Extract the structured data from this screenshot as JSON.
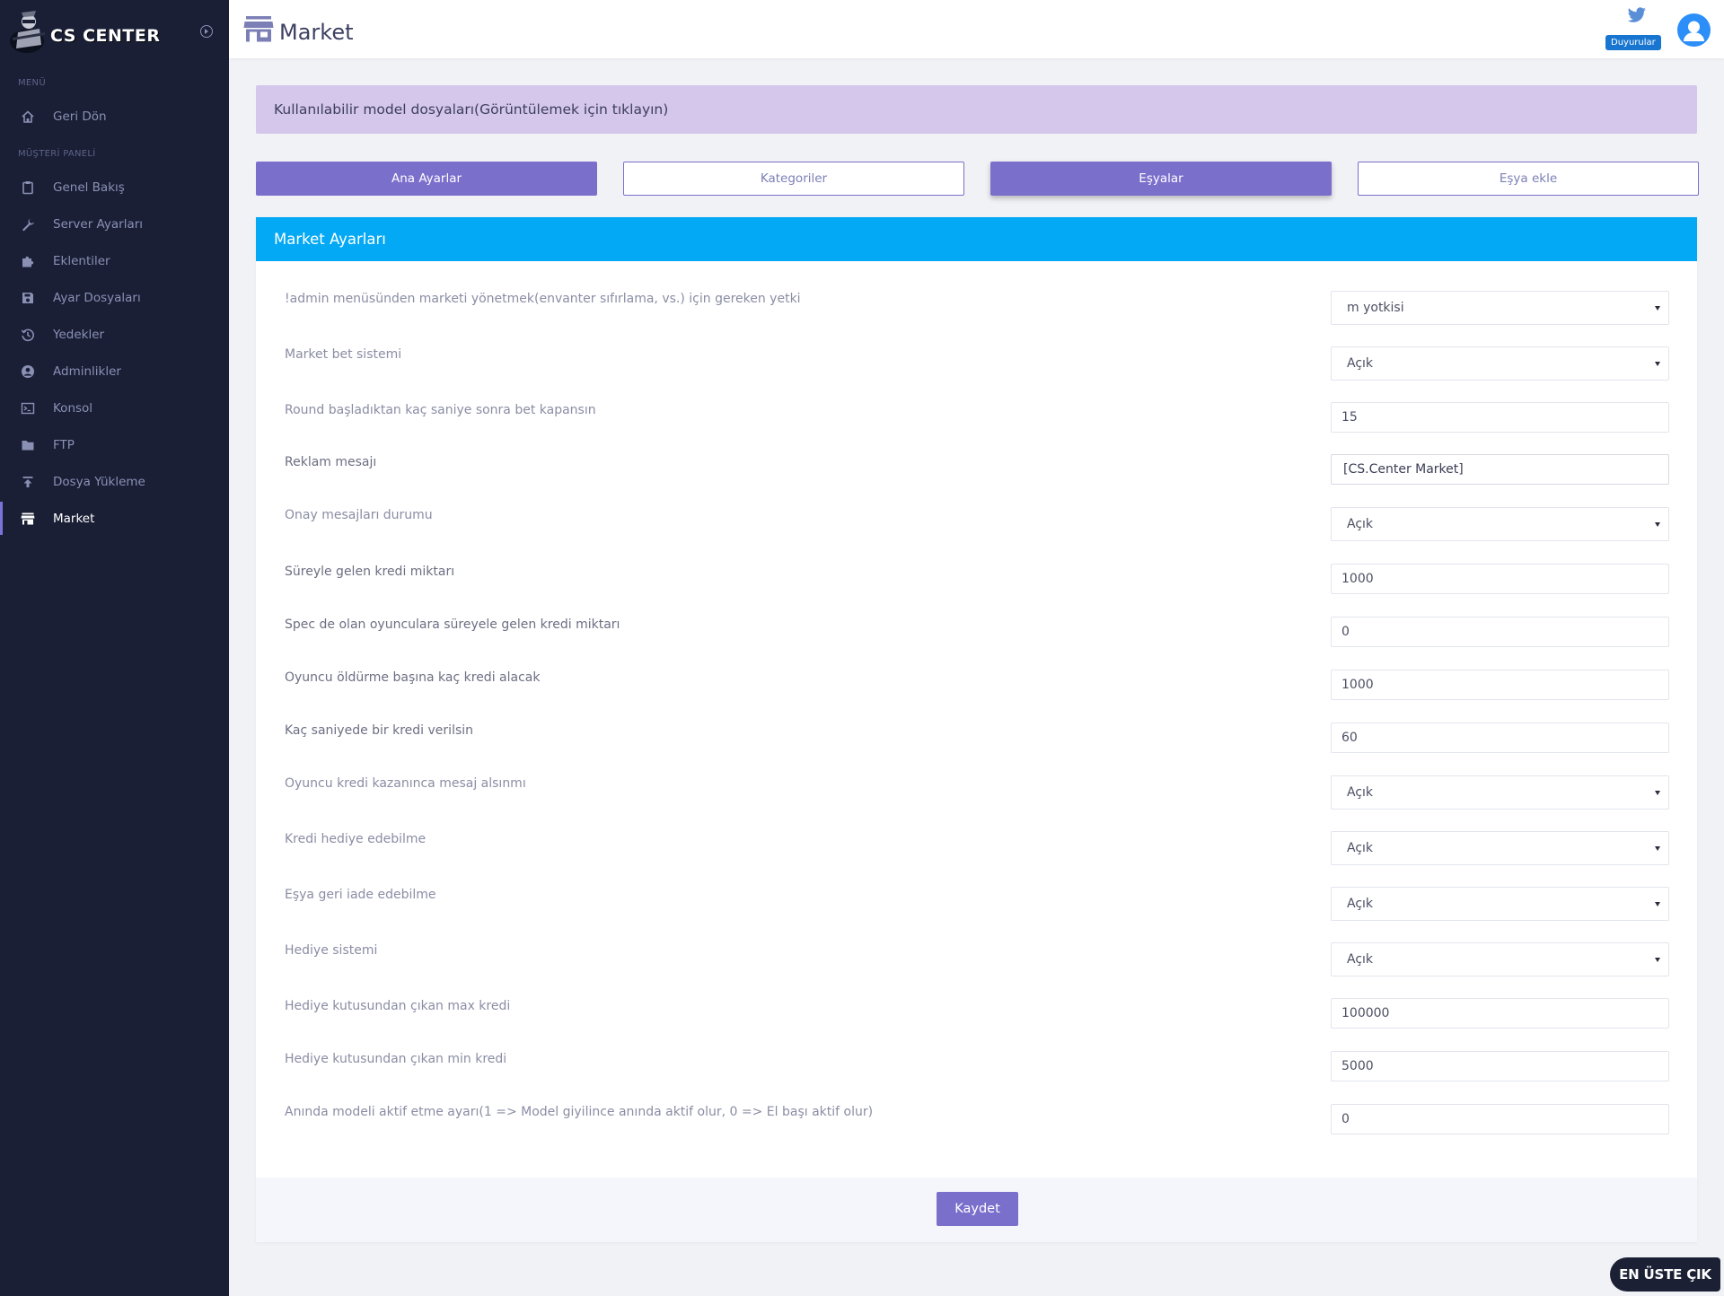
{
  "brand": {
    "name": "CS CENTER"
  },
  "sidebar": {
    "sections": {
      "menu": "MENÜ",
      "customer": "MÜŞTERİ PANELİ"
    },
    "items": [
      {
        "label": "Geri Dön",
        "icon": "home-icon"
      },
      {
        "label": "Genel Bakış",
        "icon": "clipboard-icon"
      },
      {
        "label": "Server Ayarları",
        "icon": "wrench-icon"
      },
      {
        "label": "Eklentiler",
        "icon": "puzzle-icon"
      },
      {
        "label": "Ayar Dosyaları",
        "icon": "save-icon"
      },
      {
        "label": "Yedekler",
        "icon": "history-icon"
      },
      {
        "label": "Adminlikler",
        "icon": "user-circle-icon"
      },
      {
        "label": "Konsol",
        "icon": "terminal-icon"
      },
      {
        "label": "FTP",
        "icon": "folder-icon"
      },
      {
        "label": "Dosya Yükleme",
        "icon": "upload-icon"
      },
      {
        "label": "Market",
        "icon": "store-icon",
        "active": true
      }
    ]
  },
  "header": {
    "title": "Market",
    "announcements_label": "Duyurular"
  },
  "alert": {
    "text": "Kullanılabilir model dosyaları(Görüntülemek için tıklayın)"
  },
  "tabs": [
    {
      "label": "Ana Ayarlar",
      "style": "filled"
    },
    {
      "label": "Kategoriler",
      "style": "outline"
    },
    {
      "label": "Eşyalar",
      "style": "filled"
    },
    {
      "label": "Eşya ekle",
      "style": "outline"
    }
  ],
  "card": {
    "title": "Market Ayarları",
    "rows": [
      {
        "label": "!admin menüsünden marketi yönetmek(envanter sıfırlama, vs.) için gereken yetki",
        "value": "m yotkisi",
        "type": "select"
      },
      {
        "label": "Market bet sistemi",
        "value": "Açık",
        "type": "select"
      },
      {
        "label": "Round başladıktan kaç saniye sonra bet kapansın",
        "value": "15",
        "type": "input"
      },
      {
        "label": "Reklam mesajı",
        "value": "[CS.Center Market]",
        "type": "input"
      },
      {
        "label": "Onay mesajları durumu",
        "value": "Açık",
        "type": "select"
      },
      {
        "label": "Süreyle gelen kredi miktarı",
        "value": "1000",
        "type": "input"
      },
      {
        "label": "Spec de olan oyunculara süreyele gelen kredi miktarı",
        "value": "0",
        "type": "input"
      },
      {
        "label": "Oyuncu öldürme başına kaç kredi alacak",
        "value": "1000",
        "type": "input"
      },
      {
        "label": "Kaç saniyede bir kredi verilsin",
        "value": "60",
        "type": "input"
      },
      {
        "label": "Oyuncu kredi kazanınca mesaj alsınmı",
        "value": "Açık",
        "type": "select"
      },
      {
        "label": "Kredi hediye edebilme",
        "value": "Açık",
        "type": "select"
      },
      {
        "label": "Eşya geri iade edebilme",
        "value": "Açık",
        "type": "select"
      },
      {
        "label": "Hediye sistemi",
        "value": "Açık",
        "type": "select"
      },
      {
        "label": "Hediye kutusundan çıkan max kredi",
        "value": "100000",
        "type": "input"
      },
      {
        "label": "Hediye kutusundan çıkan min kredi",
        "value": "5000",
        "type": "input"
      },
      {
        "label": "Anında modeli aktif etme ayarı(1 => Model giyilince anında aktif olur, 0 => El başı aktif olur)",
        "value": "0",
        "type": "input"
      }
    ],
    "save_label": "Kaydet"
  },
  "scroll_top_label": "EN ÜSTE ÇIK",
  "colors": {
    "sidebar_bg": "#1a1f36",
    "accent": "#7b6fcc",
    "card_header": "#03a9f4",
    "alert_bg": "#d4c7eb",
    "badge": "#1876d1"
  }
}
